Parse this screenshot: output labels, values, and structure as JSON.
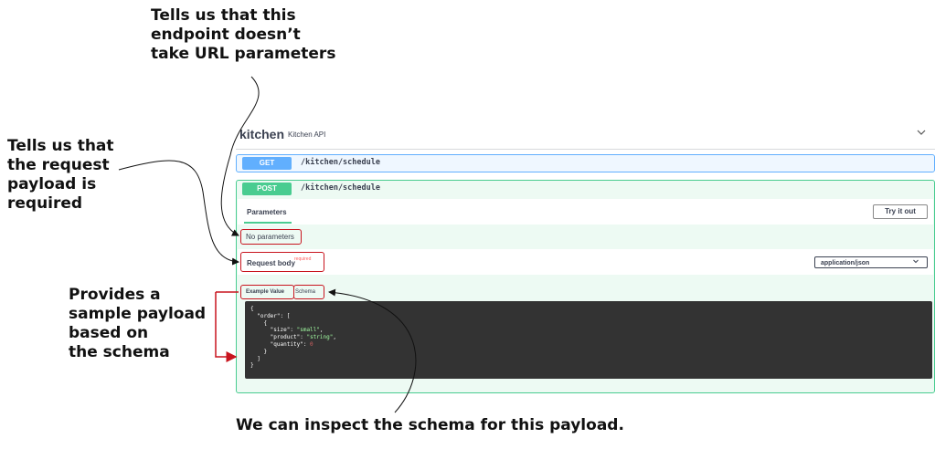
{
  "callouts": {
    "url_params": [
      "Tells us that this",
      "endpoint doesn’t",
      "take URL parameters"
    ],
    "required": [
      "Tells us that",
      "the request",
      "payload is",
      "required"
    ],
    "sample": [
      "Provides a",
      "sample payload",
      "based on",
      "the schema"
    ],
    "schema": "We can inspect the schema for this payload."
  },
  "section": {
    "title": "kitchen",
    "description": "Kitchen API",
    "toggle_icon": "chevron-down-icon"
  },
  "operations": [
    {
      "method": "GET",
      "path": "/kitchen/schedule",
      "color": "#61affe"
    },
    {
      "method": "POST",
      "path": "/kitchen/schedule",
      "color": "#49cc90"
    }
  ],
  "post_details": {
    "parameters_tab": "Parameters",
    "try_button": "Try it out",
    "no_parameters": "No parameters",
    "request_body_label": "Request body",
    "required_flag": "required",
    "content_type": "application/json",
    "example_tab": "Example Value",
    "schema_tab": "Schema"
  },
  "example_json": {
    "order_key": "order",
    "size_key": "size",
    "size_value": "small",
    "product_key": "product",
    "product_value": "string",
    "quantity_key": "quantity",
    "quantity_value": 0
  },
  "colors": {
    "highlight": "#c8141e",
    "get": "#61affe",
    "post": "#49cc90",
    "code_bg": "#333333"
  }
}
